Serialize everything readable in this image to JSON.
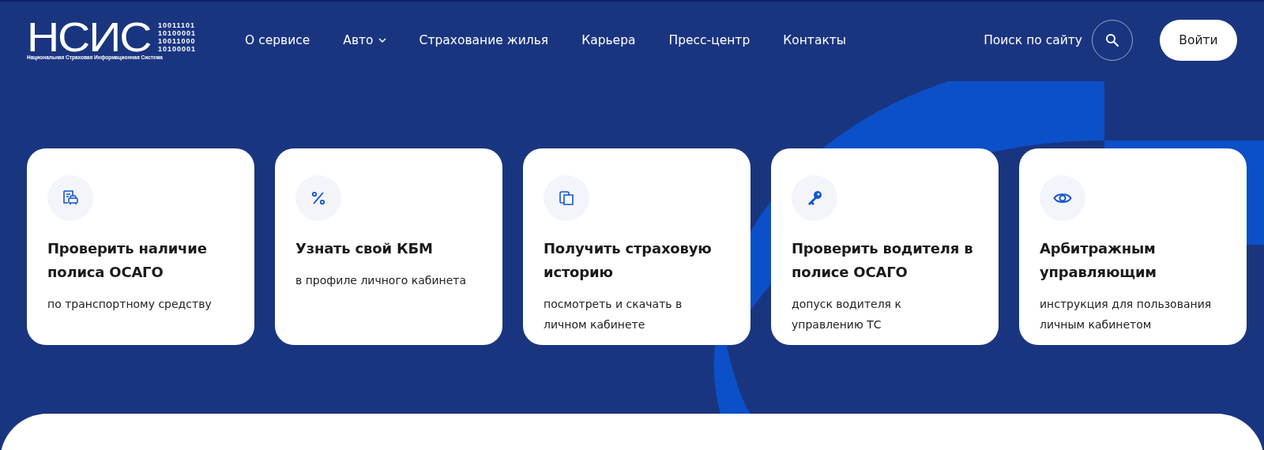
{
  "logo": {
    "wordmark": "НСИС",
    "binary": [
      "10011101",
      "10100001",
      "10011000",
      "10100001"
    ],
    "subtitle": "Национальная Страховая Информационная Система"
  },
  "nav": [
    {
      "label": "О сервисе",
      "dropdown": false
    },
    {
      "label": "Авто",
      "dropdown": true
    },
    {
      "label": "Страхование жилья",
      "dropdown": false
    },
    {
      "label": "Карьера",
      "dropdown": false
    },
    {
      "label": "Пресс-центр",
      "dropdown": false
    },
    {
      "label": "Контакты",
      "dropdown": false
    }
  ],
  "search": {
    "label": "Поиск по сайту"
  },
  "login_button": "Войти",
  "cards": [
    {
      "title": "Проверить наличие полиса ОСАГО",
      "subtitle": "по транспортному средству"
    },
    {
      "title": "Узнать свой КБМ",
      "subtitle": "в профиле личного кабинета"
    },
    {
      "title": "Получить страховую историю",
      "subtitle": "посмотреть и скачать в личном кабинете"
    },
    {
      "title": "Проверить водителя в полисе ОСАГО",
      "subtitle": "допуск водителя к управлению ТС"
    },
    {
      "title": "Арбитражным управляющим",
      "subtitle": "инструкция для пользования личным кабинетом"
    }
  ]
}
